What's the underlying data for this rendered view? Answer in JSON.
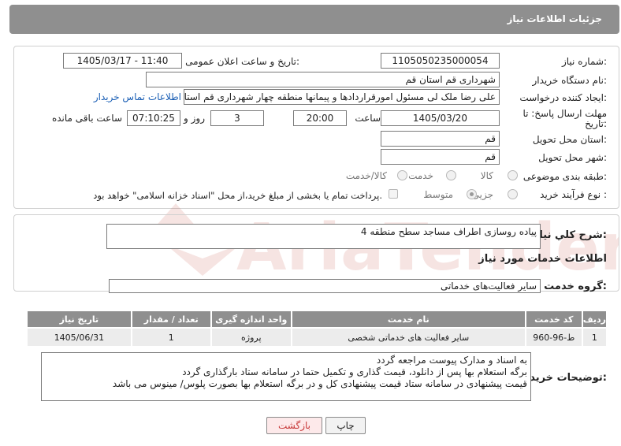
{
  "header": {
    "title": "جزئیات اطلاعات نیاز"
  },
  "form": {
    "need_number_label": "شماره نیاز:",
    "need_number": "1105050235000054",
    "announce_label": "تاریخ و ساعت اعلان عمومی:",
    "announce_value": "1405/03/17 - 11:40",
    "buyer_org_label": "نام دستگاه خریدار:",
    "buyer_org": "شهرداری قم استان قم",
    "creator_label": "ایجاد کننده درخواست:",
    "creator": "علی رضا ملک لی مسئول امورقراردادها و پیمانها منطقه چهار  شهرداری قم استان قم",
    "contact_link": "اطلاعات تماس خریدار",
    "deadline_label_1": "مهلت ارسال پاسخ: تا",
    "deadline_label_2": "تاریخ:",
    "deadline_date": "1405/03/20",
    "time_label": "ساعت",
    "deadline_time": "20:00",
    "days_value": "3",
    "days_label": "روز و",
    "remaining_time": "07:10:25",
    "remaining_label": "ساعت باقی مانده",
    "province_label": "استان محل تحویل:",
    "province": "قم",
    "city_label": "شهر محل تحویل:",
    "city": "قم",
    "category_label": "طبقه بندی موضوعی:",
    "category_options": [
      "کالا",
      "خدمت",
      "کالا/خدمت"
    ],
    "process_label": "نوع فرآیند خرید :",
    "process_options": [
      "جزیی",
      "متوسط"
    ],
    "payment_note": "پرداخت تمام یا بخشی از مبلغ خرید،از محل \"اسناد خزانه اسلامی\" خواهد بود."
  },
  "summary": {
    "label": "شرح کلي نياز:",
    "value": "پیاده روسازی اطراف مساجد سطح منطقه 4"
  },
  "services": {
    "section_title": "اطلاعات خدمات مورد نياز",
    "group_label": "گروه خدمت:",
    "group_value": "سایر فعالیت‌های خدماتی",
    "columns": [
      "ردیف",
      "کد خدمت",
      "نام خدمت",
      "واحد اندازه گیری",
      "تعداد / مقدار",
      "تاریخ نیاز"
    ],
    "rows": [
      [
        "1",
        "ط-96-960",
        "سایر فعالیت های خدماتی شخصی",
        "پروژه",
        "1",
        "1405/06/31"
      ]
    ]
  },
  "buyer_notes": {
    "label": "توضیحات خریدار:",
    "lines": [
      "به اسناد و مدارک پیوست مراجعه گردد",
      "برگه استعلام بها پس از دانلود، قیمت گذاری و تکمیل حتما در سامانه ستاد بارگذاری گردد",
      "قیمت پیشنهادی در سامانه ستاد قیمت پیشنهادی کل و در برگه استعلام بها بصورت پلوس/ مینوس می باشد"
    ]
  },
  "buttons": {
    "print": "چاپ",
    "back": "بازگشت"
  },
  "watermark": {
    "text": "AriaTender.neT"
  },
  "colors": {
    "header_bg": "#8f8f8f",
    "link": "#1b5fb5",
    "back_text": "#c83a3a",
    "watermark": "#c0392b"
  }
}
